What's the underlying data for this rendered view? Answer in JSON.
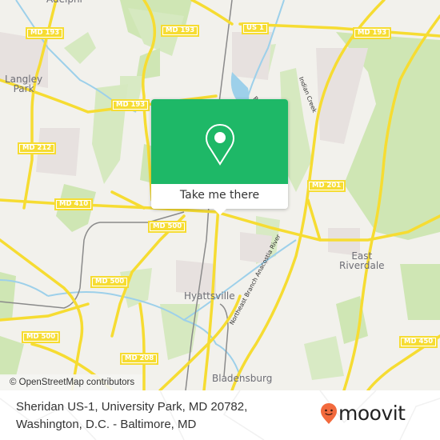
{
  "map": {
    "route_shields": [
      {
        "id": "us1",
        "label": "US 1"
      },
      {
        "id": "md193-ne",
        "label": "MD 193"
      },
      {
        "id": "md193-nw",
        "label": "MD 193"
      },
      {
        "id": "md193-w",
        "label": "MD 193"
      },
      {
        "id": "md212",
        "label": "MD 212"
      },
      {
        "id": "md201",
        "label": "MD 201"
      },
      {
        "id": "md410",
        "label": "MD 410"
      },
      {
        "id": "md500-c",
        "label": "MD 500"
      },
      {
        "id": "md500-m",
        "label": "MD 500"
      },
      {
        "id": "md500-sw",
        "label": "MD 500"
      },
      {
        "id": "md500-w",
        "label": "MD 500"
      },
      {
        "id": "md208",
        "label": "MD 208"
      },
      {
        "id": "md450",
        "label": "MD 450"
      }
    ],
    "places": {
      "adelphi": "Adelphi",
      "langley_park_1": "Langley",
      "langley_park_2": "Park",
      "hyattsville": "Hyattsville",
      "east_riverdale_1": "East",
      "east_riverdale_2": "Riverdale",
      "bladensburg": "Bladensburg"
    },
    "water_labels": {
      "indian_creek": "Indian Creek",
      "anacostia": "Northeast Branch Anacostia River",
      "paint_branch": "Paint Branch"
    },
    "attribution": "© OpenStreetMap contributors",
    "colors": {
      "land": "#f2f1ec",
      "park": "#cfe6b4",
      "water": "#9dd0ea",
      "road": "#f6dc32",
      "rail": "#888888"
    }
  },
  "popup": {
    "icon": "map-pin-icon",
    "button_label": "Take me there",
    "color": "#1eb867"
  },
  "footer": {
    "address_line1": "Sheridan US-1, University Park, MD 20782,",
    "address_line2": "Washington, D.C. - Baltimore, MD",
    "logo_text": "moovit",
    "logo_color": "#f26a3d"
  }
}
